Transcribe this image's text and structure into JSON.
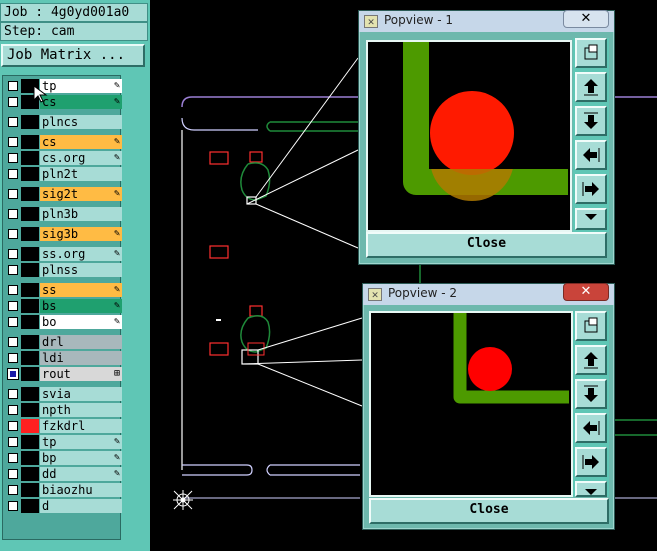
{
  "job": {
    "label": "Job : 4g0yd001a0",
    "step": "Step: cam",
    "matrix_button": "Job Matrix ..."
  },
  "layers": [
    {
      "name": "tp",
      "bg": "#ffffff",
      "mark": "✎",
      "swatch": "#000"
    },
    {
      "name": "cs",
      "bg": "#1fa06f",
      "mark": "✎",
      "swatch": "#000"
    },
    {
      "name": "plncs",
      "bg": "#a7dcd6",
      "mark": "",
      "swatch": "#000"
    },
    {
      "name": "cs",
      "bg": "#ffbb44",
      "mark": "✎",
      "swatch": "#000"
    },
    {
      "name": "cs.org",
      "bg": "#a7dcd6",
      "mark": "✎",
      "swatch": "#000"
    },
    {
      "name": "pln2t",
      "bg": "#a7dcd6",
      "mark": "",
      "swatch": "#000"
    },
    {
      "name": "sig2t",
      "bg": "#ffbb44",
      "mark": "✎",
      "swatch": "#000"
    },
    {
      "name": "pln3b",
      "bg": "#a7dcd6",
      "mark": "",
      "swatch": "#000"
    },
    {
      "name": "sig3b",
      "bg": "#ffbb44",
      "mark": "✎",
      "swatch": "#000"
    },
    {
      "name": "ss.org",
      "bg": "#a7dcd6",
      "mark": "✎",
      "swatch": "#000"
    },
    {
      "name": "plnss",
      "bg": "#a7dcd6",
      "mark": "",
      "swatch": "#000"
    },
    {
      "name": "ss",
      "bg": "#ffbb44",
      "mark": "✎",
      "swatch": "#000"
    },
    {
      "name": "bs",
      "bg": "#1fa06f",
      "mark": "✎",
      "swatch": "#000"
    },
    {
      "name": "bo",
      "bg": "#ffffff",
      "mark": "✎",
      "swatch": "#000"
    },
    {
      "name": "drl",
      "bg": "#a8b8bc",
      "mark": "",
      "swatch": "#000"
    },
    {
      "name": "ldi",
      "bg": "#a8b8bc",
      "mark": "",
      "swatch": "#000"
    },
    {
      "name": "rout",
      "bg": "#d8d8d8",
      "mark": "⊞",
      "swatch": "#000",
      "checked": true
    },
    {
      "name": "svia",
      "bg": "#a7dcd6",
      "mark": "",
      "swatch": "#000"
    },
    {
      "name": "npth",
      "bg": "#a7dcd6",
      "mark": "",
      "swatch": "#000"
    },
    {
      "name": "fzkdrl",
      "bg": "#a7dcd6",
      "mark": "",
      "swatch": "#ff2020"
    },
    {
      "name": "tp",
      "bg": "#a7dcd6",
      "mark": "✎",
      "swatch": "#000"
    },
    {
      "name": "bp",
      "bg": "#a7dcd6",
      "mark": "✎",
      "swatch": "#000"
    },
    {
      "name": "dd",
      "bg": "#a7dcd6",
      "mark": "✎",
      "swatch": "#000"
    },
    {
      "name": "biaozhu",
      "bg": "#a7dcd6",
      "mark": "",
      "swatch": "#000"
    },
    {
      "name": "d",
      "bg": "#a7dcd6",
      "mark": "",
      "swatch": "#000"
    }
  ],
  "popviews": [
    {
      "title": "Popview - 1",
      "close_x": "✕",
      "close_label": "Close"
    },
    {
      "title": "Popview - 2",
      "close_x": "✕",
      "close_label": "Close"
    }
  ],
  "colors": {
    "panel": "#5fc6b5",
    "button": "#a7dcd6",
    "trace": "#4d9a00",
    "pad": "#ff0000",
    "outline": "#9b7fd4"
  },
  "icons": [
    "zoom-window-icon",
    "pan-up-icon",
    "pan-down-icon",
    "pan-left-icon",
    "pan-right-icon",
    "zoom-fit-icon",
    "cursor-icon",
    "crosshair-icon"
  ]
}
